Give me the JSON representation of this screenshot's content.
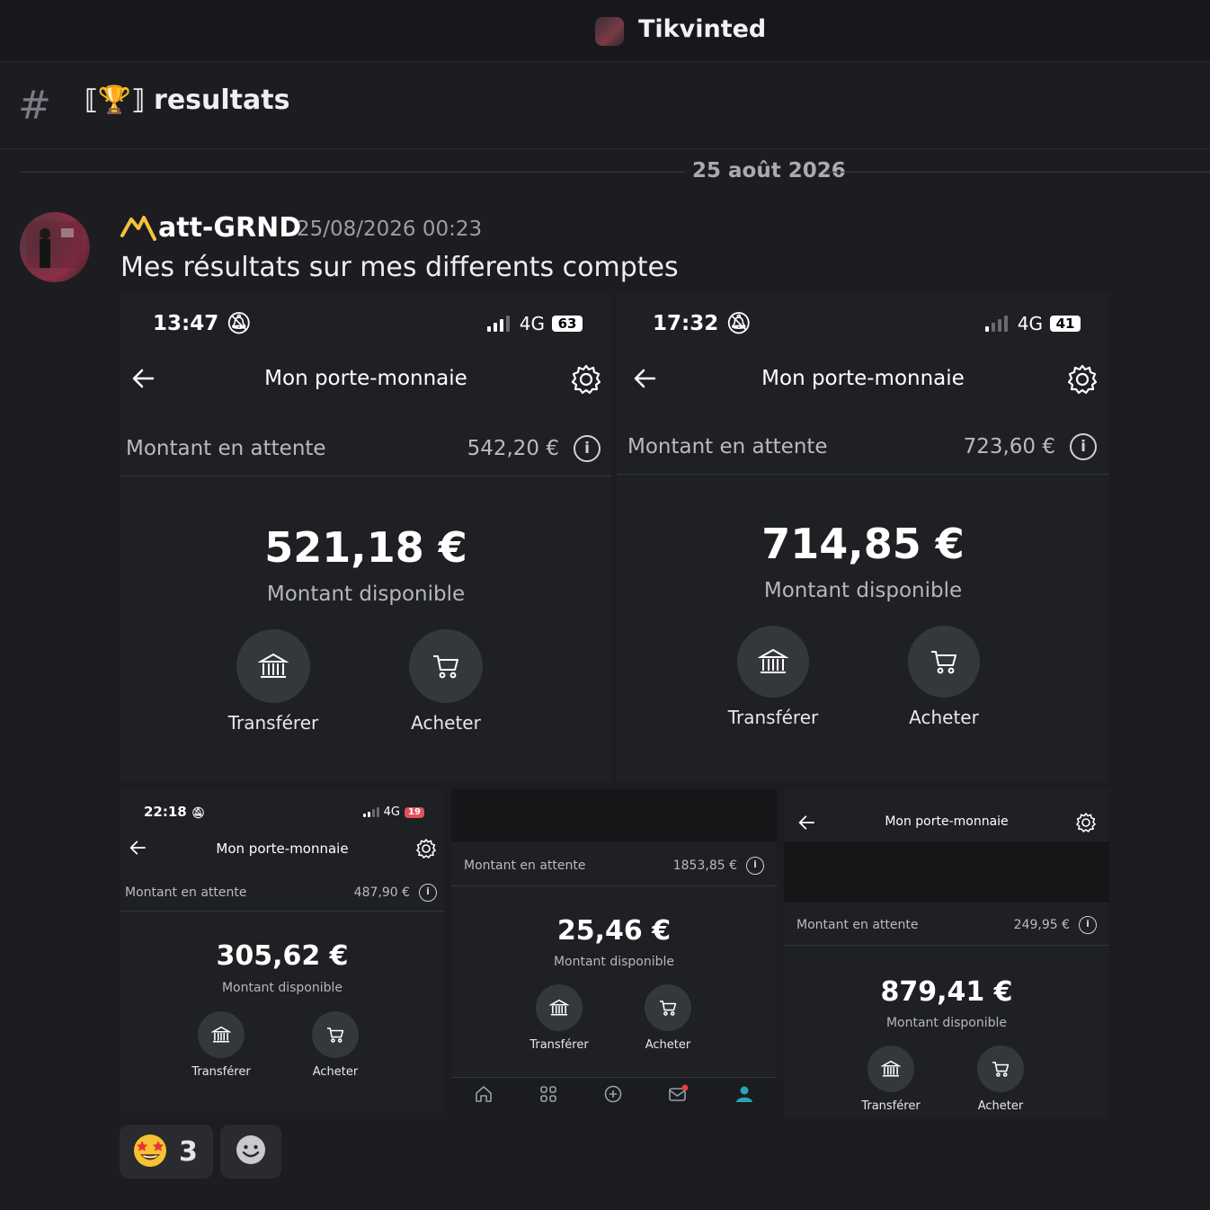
{
  "server": {
    "name": "Tikvinted"
  },
  "channel": {
    "name": "⟦🏆⟧ resultats"
  },
  "date_divider": "25 août 2026",
  "message": {
    "author": "att-GRND",
    "timestamp": "25/08/2026 00:23",
    "text": "Mes résultats sur mes differents comptes"
  },
  "shots": [
    {
      "time": "13:47",
      "network": "4G",
      "battery": "63",
      "title": "Mon porte-monnaie",
      "pending_label": "Montant en attente",
      "pending": "542,20 €",
      "available": "521,18 €",
      "available_label": "Montant disponible",
      "transfer": "Transférer",
      "buy": "Acheter"
    },
    {
      "time": "17:32",
      "network": "4G",
      "battery": "41",
      "title": "Mon porte-monnaie",
      "pending_label": "Montant en attente",
      "pending": "723,60 €",
      "available": "714,85 €",
      "available_label": "Montant disponible",
      "transfer": "Transférer",
      "buy": "Acheter"
    },
    {
      "time": "22:18",
      "network": "4G",
      "battery": "19",
      "title": "Mon porte-monnaie",
      "pending_label": "Montant en attente",
      "pending": "487,90 €",
      "available": "305,62 €",
      "available_label": "Montant disponible",
      "transfer": "Transférer",
      "buy": "Acheter"
    },
    {
      "pending_label": "Montant en attente",
      "pending": "1853,85 €",
      "available": "25,46 €",
      "available_label": "Montant disponible",
      "transfer": "Transférer",
      "buy": "Acheter"
    },
    {
      "title": "Mon porte-monnaie",
      "pending_label": "Montant en attente",
      "pending": "249,95 €",
      "available": "879,41 €",
      "available_label": "Montant disponible",
      "transfer": "Transférer",
      "buy": "Acheter"
    }
  ],
  "reactions": [
    {
      "emoji": "🤩",
      "count": "3"
    },
    {
      "emoji": "add-reaction-icon"
    }
  ]
}
